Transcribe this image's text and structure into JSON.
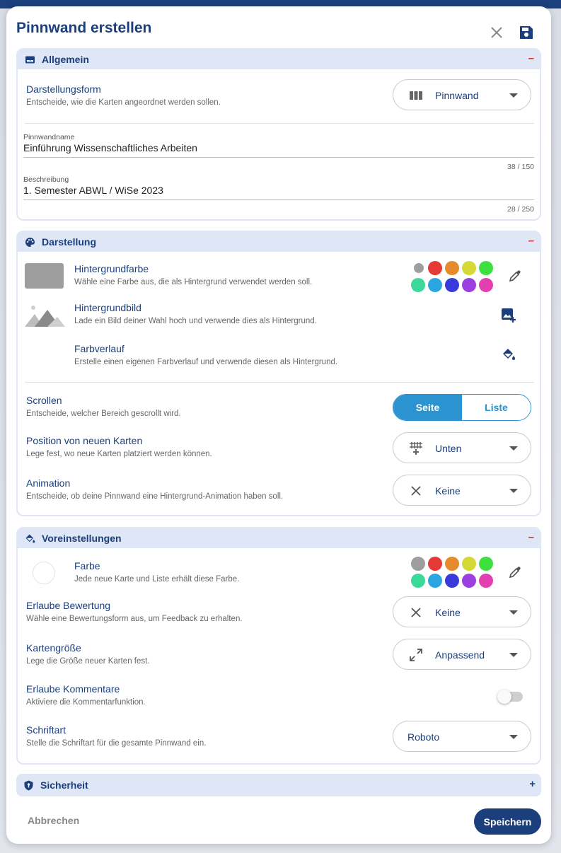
{
  "dialog": {
    "title": "Pinnwand erstellen"
  },
  "sections": {
    "allgemein": {
      "title": "Allgemein",
      "toggle": "–"
    },
    "darstellung": {
      "title": "Darstellung",
      "toggle": "–"
    },
    "voreinstellungen": {
      "title": "Voreinstellungen",
      "toggle": "–"
    },
    "sicherheit": {
      "title": "Sicherheit",
      "toggle": "+"
    }
  },
  "allgemein": {
    "darstellungsform": {
      "label": "Darstellungsform",
      "desc": "Entscheide, wie die Karten angeordnet werden sollen.",
      "value": "Pinnwand",
      "icon": "columns-icon"
    },
    "pinnwandname": {
      "label": "Pinnwandname",
      "value": "Einführung Wissenschaftliches Arbeiten",
      "counter": "38 / 150"
    },
    "beschreibung": {
      "label": "Beschreibung",
      "value": "1. Semester ABWL / WiSe 2023",
      "counter": "28 / 250"
    }
  },
  "darstellung": {
    "hintergrundfarbe": {
      "label": "Hintergrundfarbe",
      "desc": "Wähle eine Farbe aus, die als Hintergrund verwendet werden soll.",
      "preview_color": "#9e9e9e"
    },
    "hintergrundbild": {
      "label": "Hintergrundbild",
      "desc": "Lade ein Bild deiner Wahl hoch und verwende dies als Hintergrund."
    },
    "farbverlauf": {
      "label": "Farbverlauf",
      "desc": "Erstelle einen eigenen Farbverlauf und verwende diesen als Hintergrund."
    },
    "swatches_row1": [
      "#9e9e9e",
      "#e53935",
      "#e68a2e",
      "#d4d936",
      "#3ee040"
    ],
    "swatches_row2": [
      "#3ad99a",
      "#2aa5e0",
      "#3a3adb",
      "#9b3fe0",
      "#e23fb0"
    ],
    "scrollen": {
      "label": "Scrollen",
      "desc": "Entscheide, welcher Bereich gescrollt wird.",
      "option_a": "Seite",
      "option_b": "Liste"
    },
    "position": {
      "label": "Position von neuen Karten",
      "desc": "Lege fest, wo neue Karten platziert werden können.",
      "value": "Unten"
    },
    "animation": {
      "label": "Animation",
      "desc": "Entscheide, ob deine Pinnwand eine Hintergrund-Animation haben soll.",
      "value": "Keine"
    }
  },
  "voreinstellungen": {
    "farbe": {
      "label": "Farbe",
      "desc": "Jede neue Karte und Liste erhält diese Farbe."
    },
    "swatches_row1": [
      "#9e9e9e",
      "#e53935",
      "#e68a2e",
      "#d4d936",
      "#3ee040"
    ],
    "swatches_row2": [
      "#3ad99a",
      "#2aa5e0",
      "#3a3adb",
      "#9b3fe0",
      "#e23fb0"
    ],
    "bewertung": {
      "label": "Erlaube Bewertung",
      "desc": "Wähle eine Bewertungsform aus, um Feedback zu erhalten.",
      "value": "Keine"
    },
    "kartengroesse": {
      "label": "Kartengröße",
      "desc": "Lege die Größe neuer Karten fest.",
      "value": "Anpassend"
    },
    "kommentare": {
      "label": "Erlaube Kommentare",
      "desc": "Aktiviere die Kommentarfunktion.",
      "enabled": false
    },
    "schriftart": {
      "label": "Schriftart",
      "desc": "Stelle die Schriftart für die gesamte Pinnwand ein.",
      "value": "Roboto"
    }
  },
  "footer": {
    "cancel": "Abbrechen",
    "save": "Speichern"
  },
  "colors": {
    "primary": "#1b3f7c",
    "accent": "#2b93d0",
    "section_bg": "#dfe7f6",
    "danger": "#e0281f"
  }
}
